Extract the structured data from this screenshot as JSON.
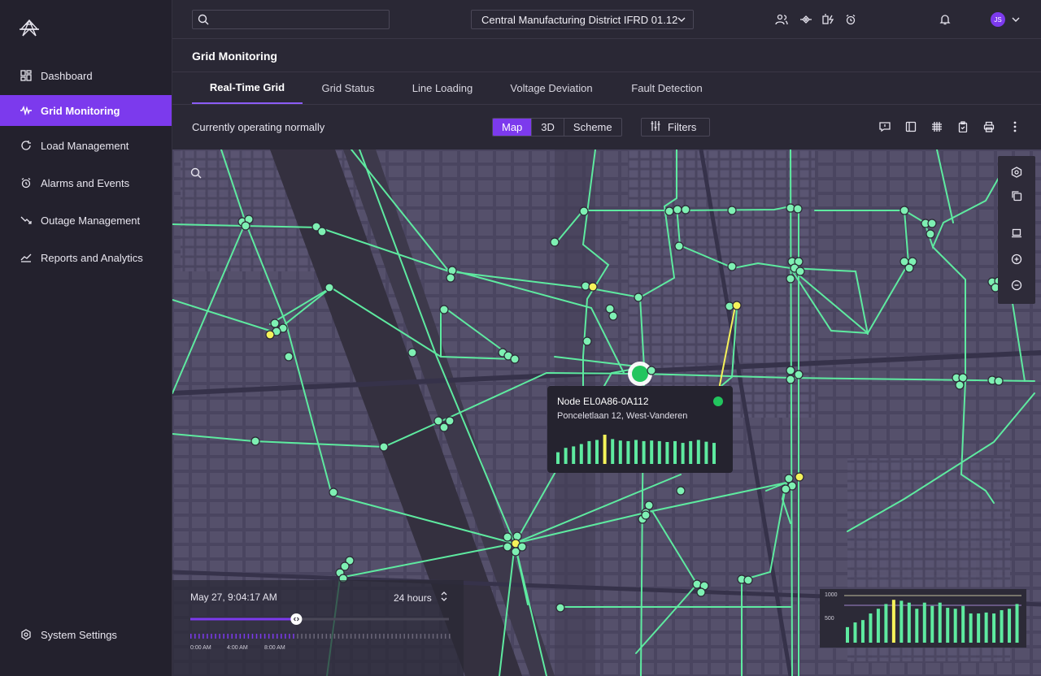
{
  "sidebar": {
    "items": [
      {
        "label": "Dashboard",
        "icon": "dashboard-icon"
      },
      {
        "label": "Grid Monitoring",
        "icon": "waveform-icon",
        "active": true
      },
      {
        "label": "Load Management",
        "icon": "refresh-icon"
      },
      {
        "label": "Alarms and Events",
        "icon": "alarm-icon"
      },
      {
        "label": "Outage Management",
        "icon": "trend-down-icon"
      },
      {
        "label": "Reports and Analytics",
        "icon": "trend-up-icon"
      }
    ],
    "settings": {
      "label": "System Settings",
      "icon": "gear-icon"
    }
  },
  "topbar": {
    "search_placeholder": "",
    "district": "Central Manufacturing District IFRD 01.12",
    "user_initials": "JS"
  },
  "page": {
    "title": "Grid Monitoring",
    "tabs": [
      "Real-Time Grid",
      "Grid Status",
      "Line Loading",
      "Voltage Deviation",
      "Fault Detection"
    ],
    "active_tab": "Real-Time Grid"
  },
  "toolbar": {
    "status": "Currently operating normally",
    "views": [
      "Map",
      "3D",
      "Scheme"
    ],
    "active_view": "Map",
    "filters_label": "Filters"
  },
  "tooltip": {
    "title": "Node EL0A86-0A112",
    "address": "Ponceletlaan 12, West-Vanderen",
    "status_color": "#22c55e",
    "bars": [
      0.4,
      0.55,
      0.6,
      0.68,
      0.78,
      0.82,
      1.0,
      0.85,
      0.8,
      0.78,
      0.82,
      0.78,
      0.8,
      0.78,
      0.75,
      0.78,
      0.72,
      0.78,
      0.82,
      0.76,
      0.72
    ]
  },
  "timeline": {
    "datetime": "May 27, 9:04:17 AM",
    "range": "24 hours",
    "ticks": [
      "0:00 AM",
      "4:00 AM",
      "8:00 AM"
    ],
    "progress": 0.41
  },
  "minichart": {
    "y_labels": [
      "1000",
      "500"
    ],
    "bars": [
      0.33,
      0.43,
      0.48,
      0.62,
      0.72,
      0.82,
      0.91,
      0.89,
      0.85,
      0.72,
      0.85,
      0.78,
      0.85,
      0.74,
      0.72,
      0.78,
      0.62,
      0.62,
      0.64,
      0.62,
      0.69,
      0.72,
      0.82
    ]
  },
  "colors": {
    "accent": "#7c3aed",
    "line": "#5eeaa0",
    "warning": "#f5f25a",
    "ok": "#22c55e"
  }
}
